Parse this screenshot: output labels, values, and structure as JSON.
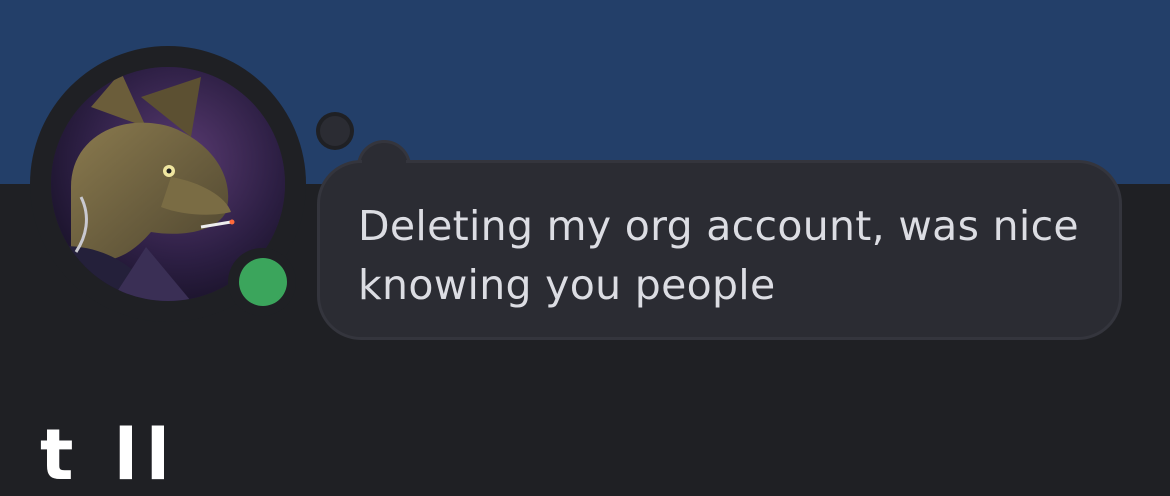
{
  "profile": {
    "custom_status_text": "Deleting my org account, was nice knowing you people",
    "online_status": "online",
    "username_partial": "t ll"
  },
  "colors": {
    "banner": "#233f69",
    "background": "#1f2024",
    "bubble": "#2b2c33",
    "status_online": "#3ba55c",
    "text": "#dcdde3"
  },
  "icons": {
    "avatar": "avatar-illustration",
    "status": "online-status-icon"
  }
}
